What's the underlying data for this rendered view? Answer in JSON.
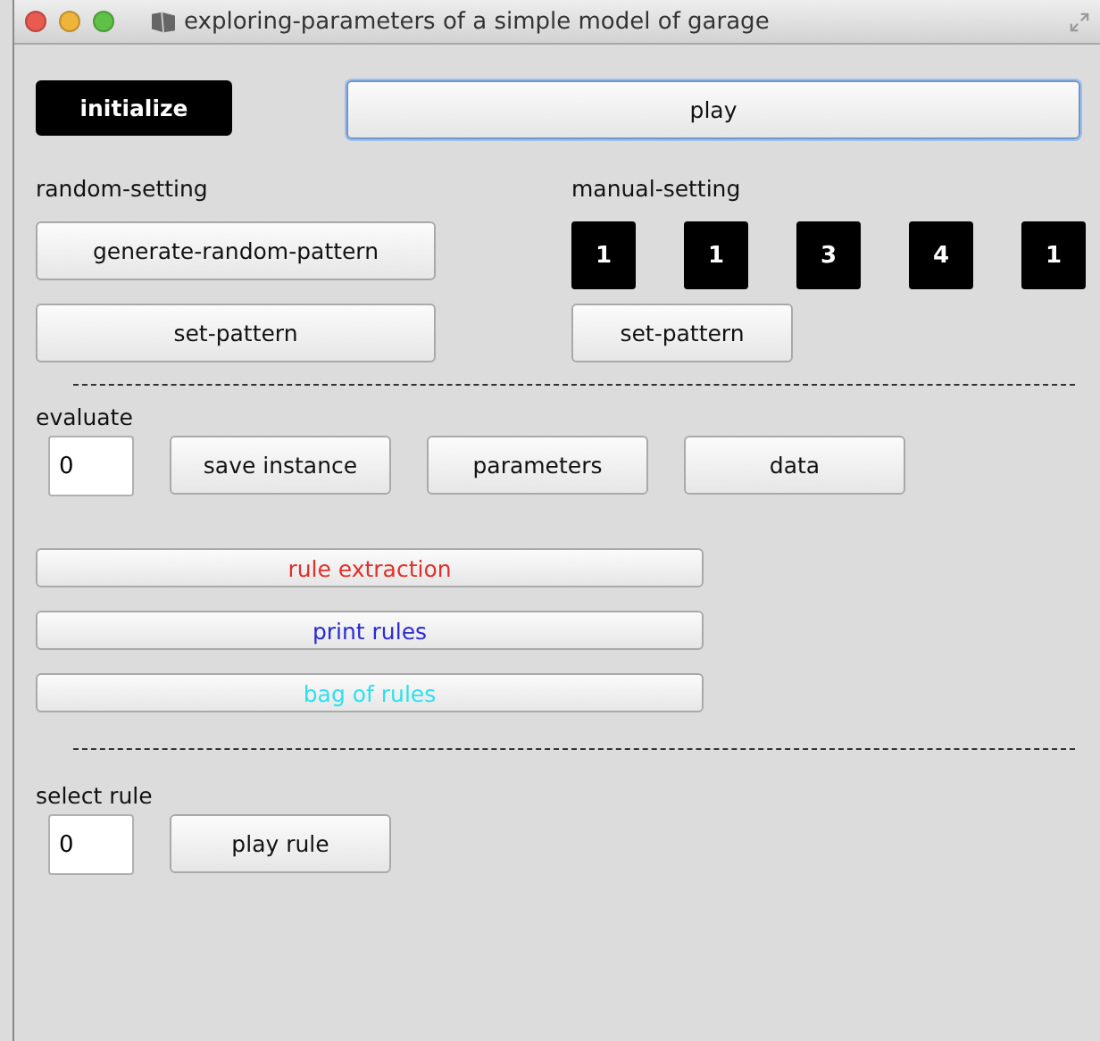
{
  "window": {
    "title": "exploring-parameters of a simple model of garage"
  },
  "top_buttons": [
    {
      "label": "initialize",
      "kind": "dark"
    },
    {
      "label": "play",
      "kind": "default"
    }
  ],
  "random_setting": {
    "label": "random-setting",
    "buttons": [
      "generate-random-pattern",
      "set-pattern"
    ]
  },
  "manual_setting": {
    "label": "manual-setting",
    "values": [
      "1",
      "1",
      "3",
      "4",
      "1"
    ],
    "button": "set-pattern"
  },
  "evaluate": {
    "label": "evaluate",
    "value": "0",
    "buttons": [
      "save instance",
      "parameters",
      "data"
    ]
  },
  "rule_buttons": [
    {
      "label": "rule extraction",
      "color": "#e0302a"
    },
    {
      "label": "print rules",
      "color": "#2a2ad6"
    },
    {
      "label": "bag of rules",
      "color": "#2ee0ee"
    }
  ],
  "select_rule": {
    "label": "select rule",
    "value": "0",
    "button": "play rule"
  }
}
